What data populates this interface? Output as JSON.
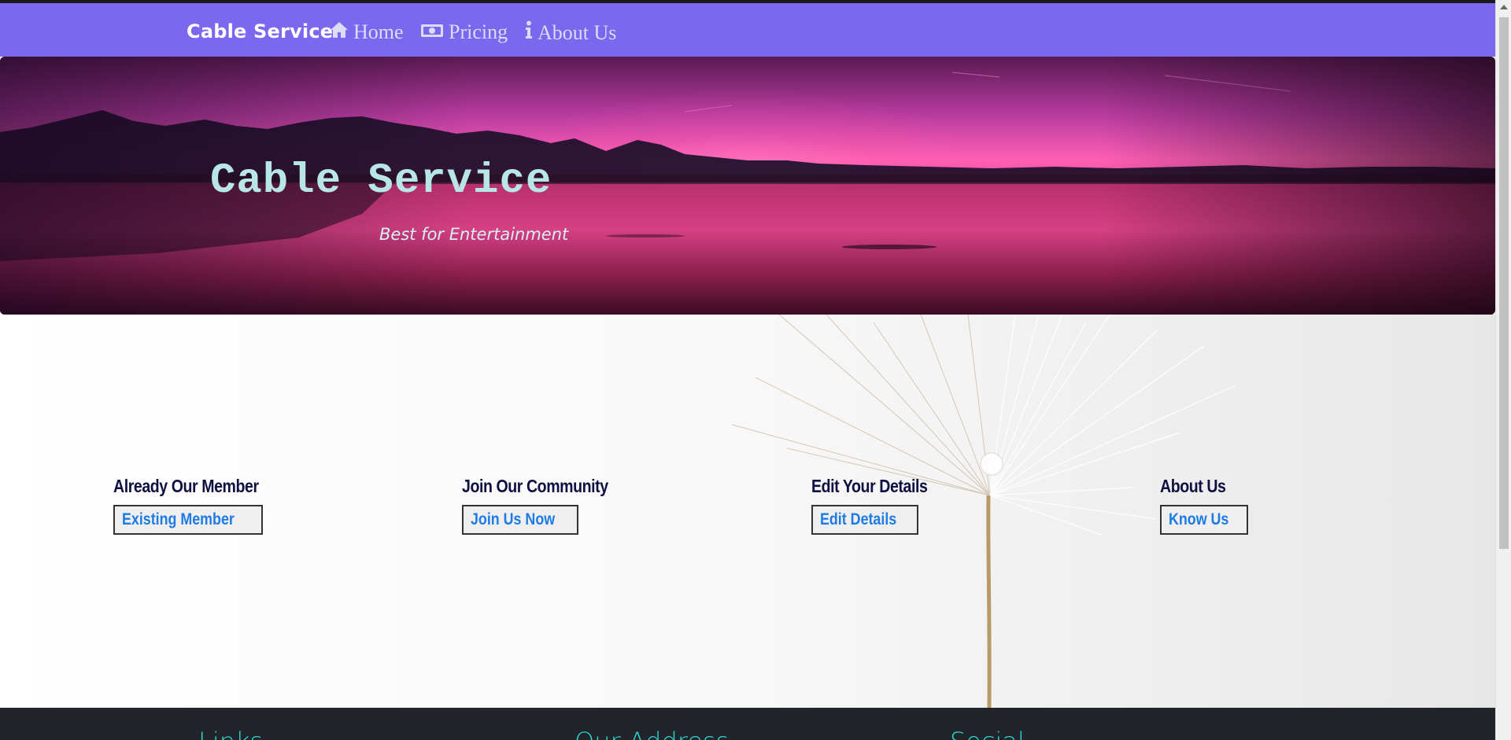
{
  "navbar": {
    "brand": "Cable Service",
    "links": [
      {
        "label": "Home",
        "icon": "home-icon"
      },
      {
        "label": "Pricing",
        "icon": "money-icon"
      },
      {
        "label": "About Us",
        "icon": "info-icon"
      }
    ],
    "background": "#7b68ee"
  },
  "hero": {
    "title": "Cable Service",
    "subtitle": "Best for Entertainment"
  },
  "cards": [
    {
      "heading": "Already Our Member",
      "button": "Existing Member"
    },
    {
      "heading": "Join Our Community",
      "button": "Join Us Now"
    },
    {
      "heading": "Edit Your Details",
      "button": "Edit Details"
    },
    {
      "heading": "About Us",
      "button": "Know Us"
    }
  ],
  "footer": {
    "headings": [
      "Links",
      "Our Address",
      "Social"
    ],
    "background": "#212529",
    "accent": "#28d7d3"
  }
}
